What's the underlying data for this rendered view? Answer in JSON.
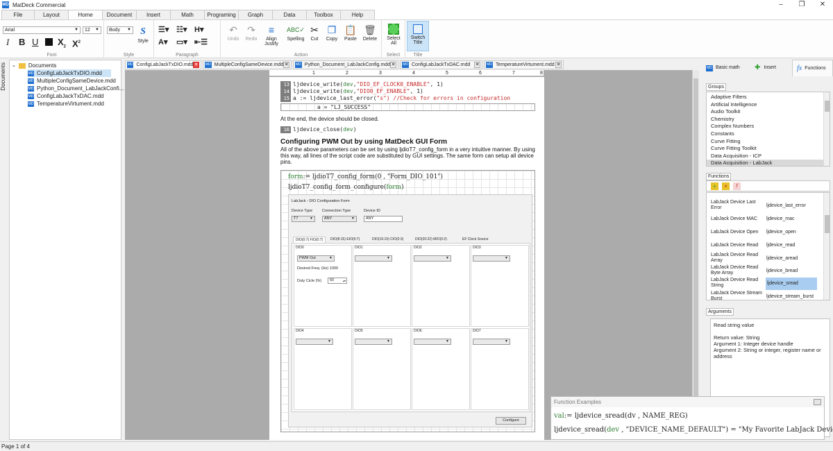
{
  "app": {
    "title": "MatDeck Commercial",
    "logo": "MD"
  },
  "window_controls": {
    "minimize": "–",
    "maximize": "❐",
    "close": "✕"
  },
  "menu_tabs": [
    "File",
    "Layout",
    "Home",
    "Document",
    "Insert",
    "Math",
    "Programing",
    "Graph",
    "Data",
    "Toolbox",
    "Help"
  ],
  "ribbon": {
    "font": {
      "family": "Arial",
      "size": "12",
      "label": "Font"
    },
    "style": {
      "value": "Body",
      "button": "Style",
      "label": "Style"
    },
    "paragraph": {
      "label": "Paragraph"
    },
    "action": {
      "undo": "Undo",
      "redo": "Redo",
      "align": "Align Justify",
      "spelling": "Spelling",
      "cut": "Cut",
      "copy": "Copy",
      "paste": "Paste",
      "delete": "Delete",
      "label": "Action"
    },
    "select": {
      "button": "Select All",
      "label": "Select"
    },
    "title": {
      "button": "Switch Title",
      "label": "Title"
    }
  },
  "sidebar": {
    "vertical_label": "Documents",
    "root": "Documents",
    "files": [
      "ConfigLabJackTxDIO.mdd",
      "MultipleConfigSameDevice.mdd",
      "Python_Document_LabJackConfi...",
      "ConfigLabJackTxDAC.mdd",
      "TemperatureVirtument.mdd"
    ]
  },
  "doc_tabs": [
    "ConfigLabJackTxDIO.mdd",
    "MultipleConfigSameDevice.mdd",
    "Python_Document_LabJackConfig.mdd",
    "ConfigLabJackTxDAC.mdd",
    "TemperatureVirtument.mdd"
  ],
  "ruler": [
    "1",
    "2",
    "3",
    "4",
    "5",
    "6",
    "7",
    "8"
  ],
  "document": {
    "code_lines": [
      {
        "no": "13",
        "fn": "ljdevice_write(",
        "arg": "dev",
        "mid": ",",
        "str": "\"DIO_EF_CLOCK0_ENABLE\"",
        "end": ", 1)"
      },
      {
        "no": "14",
        "fn": "ljdevice_write(",
        "arg": "dev",
        "mid": ",",
        "str": "\"DIO0_EF_ENABLE\"",
        "end": ", 1)"
      },
      {
        "no": "15",
        "fn": "a := ljdevice_last_error(",
        "arg": "",
        "mid": "",
        "str": "\"s\"",
        "end": ") //Check for errors in configuration"
      }
    ],
    "result": "a = \"LJ_SUCCESS\"",
    "para1": "At the end, the device should be closed.",
    "close_line": {
      "no": "16",
      "fn": "ljdevice_close(",
      "arg": "dev",
      "end": ")"
    },
    "heading": "Configuring PWM Out by using MatDeck GUI Form",
    "para2": "All of the above parameters can be set by using ljdioT7_config_form in a very intuitive manner. By using this way, all lines of the script code are substituted by GUI settings. The same form can setup all device pins.",
    "formula1_a": "form",
    "formula1_b": ":= ljdioT7_config_form(0 , \"Form_DIO_101\")",
    "formula2_a": "ljdioT7_config_form_configure(",
    "formula2_b": "form",
    "formula2_c": ")",
    "form": {
      "title": "LabJack - DIO Configuration Form",
      "device_type_label": "Device Type",
      "device_type": "T7",
      "conn_type_label": "Connection Type",
      "conn_type": "ANY",
      "device_id_label": "Device ID",
      "device_id": "ANY",
      "tabs": [
        "DIO(0:7) FIO(0:7)",
        "DIO(8:15) EIO(0:7)",
        "DIO(16:19) CIO(0:3)",
        "DIO(20:22) MIO(0:2)",
        "EF Clock Source"
      ],
      "dio_top": [
        "DIO0",
        "DIO1",
        "DIO2",
        "DIO3"
      ],
      "dio_bottom": [
        "DIO4",
        "DIO5",
        "DIO6",
        "DIO7"
      ],
      "dio0_mode": "PWM Out",
      "freq_label": "Desired Freq. (Hz) 1000",
      "duty_label": "Duty Cicle (%)",
      "duty_value": "50",
      "configure": "Configure"
    }
  },
  "right_panel": {
    "tabs": [
      "Basic math",
      "Insert",
      "Functions"
    ],
    "groups_label": "Groups",
    "groups": [
      "Adaptive Filters",
      "Artificial Intelligence",
      "Audio Toolkit",
      "Chemistry",
      "Complex Numbers",
      "Constants",
      "Curve Fitting",
      "Curve Fitting Toolkit",
      "Data Acquisition - ICP",
      "Data Acquisition - LabJack"
    ],
    "functions_label": "Functions",
    "functions": [
      {
        "name": "LabJack Device Last Error",
        "fn": "ljdevice_last_error"
      },
      {
        "name": "LabJack Device MAC",
        "fn": "ljdevice_mac"
      },
      {
        "name": "LabJack Device Open",
        "fn": "ljdevice_open"
      },
      {
        "name": "LabJack Device Read",
        "fn": "ljdevice_read"
      },
      {
        "name": "LabJack Device Read Array",
        "fn": "ljdevice_aread"
      },
      {
        "name": "LabJack Device Read Byte Array",
        "fn": "ljdevice_bread"
      },
      {
        "name": "LabJack Device Read String",
        "fn": "ljdevice_sread"
      },
      {
        "name": "LabJack Device Stream Burst",
        "fn": "ljdevice_stream_burst"
      }
    ],
    "arguments_label": "Arguments",
    "arguments_text": [
      "Read string value",
      "",
      "Return value: String",
      "Argument 1: Integer device handle",
      "Argument 2: String or integer, register name or address"
    ]
  },
  "examples": {
    "title": "Function Examples",
    "ex1_a": "val",
    "ex1_b": ":= ljdevice_sread(dv , NAME_REG)",
    "ex2_a": "ljdevice_sread(",
    "ex2_b": "dev",
    "ex2_c": " , \"DEVICE_NAME_DEFAULT\") = \"My Favorite LabJack Device\""
  },
  "status": "Page 1 of 4"
}
